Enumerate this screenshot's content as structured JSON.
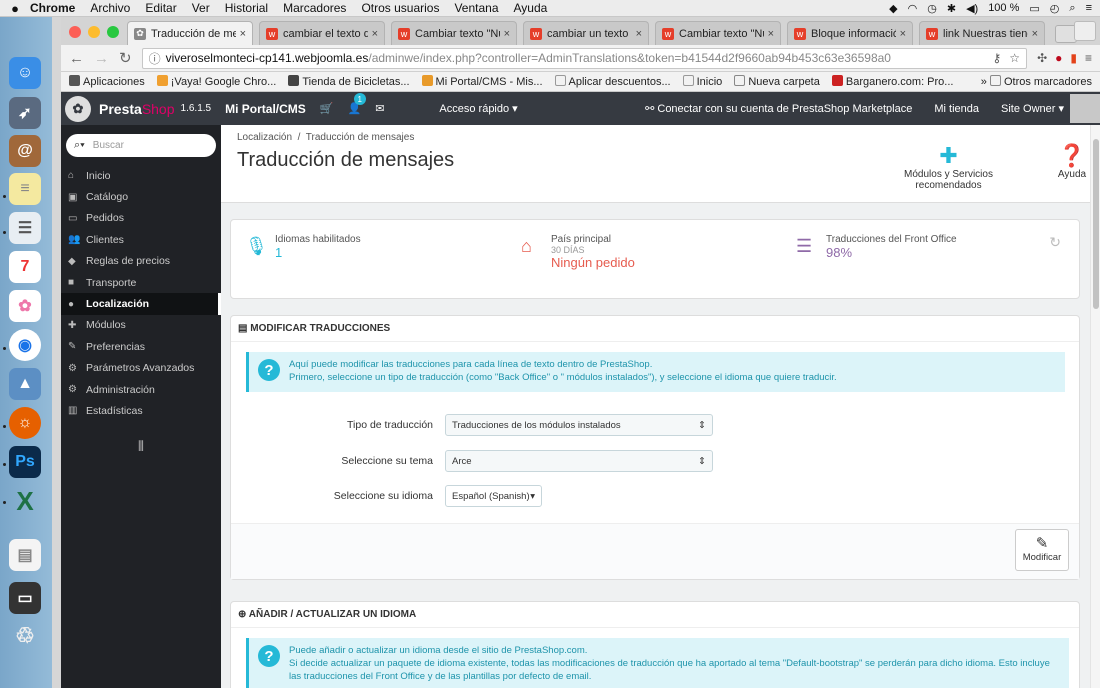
{
  "mac_menu": {
    "app": "Chrome",
    "items": [
      "Archivo",
      "Editar",
      "Ver",
      "Historial",
      "Marcadores",
      "Otros usuarios",
      "Ventana",
      "Ayuda"
    ],
    "battery": "100 %"
  },
  "tabs": [
    {
      "title": "Traducción de mensajes",
      "active": true
    },
    {
      "title": "cambiar el texto de los"
    },
    {
      "title": "Cambiar texto \"Nuestras"
    },
    {
      "title": "cambiar un texto"
    },
    {
      "title": "Cambiar texto \"Nuestras"
    },
    {
      "title": "Bloque información"
    },
    {
      "title": "link Nuestras tiendas"
    }
  ],
  "address": {
    "host": "viveroselmonteci-cp141.webjoomla.es",
    "path": "/adminwe/index.php?controller=AdminTranslations&token=b41544d2f9660ab94b453c63e36598a0"
  },
  "bookmarks": {
    "items": [
      "Aplicaciones",
      "¡Vaya! Google Chro...",
      "Tienda de Bicicletas...",
      "Mi Portal/CMS - Mis...",
      "Aplicar descuentos...",
      "Inicio",
      "Nueva carpeta",
      "Barganero.com: Pro..."
    ],
    "other": "Otros marcadores"
  },
  "header": {
    "brand_a": "Presta",
    "brand_b": "Shop",
    "version": "1.6.1.5",
    "portal": "Mi Portal/CMS",
    "badge": "1",
    "quick_access": "Acceso rápido",
    "connect": "Conectar con su cuenta de PrestaShop Marketplace",
    "my_store": "Mi tienda",
    "owner": "Site Owner"
  },
  "sidebar": {
    "search_placeholder": "Buscar",
    "items": [
      {
        "label": "Inicio",
        "icon": "home-icon",
        "glyph": "⌂"
      },
      {
        "label": "Catálogo",
        "icon": "catalog-icon",
        "glyph": "▣"
      },
      {
        "label": "Pedidos",
        "icon": "credit-card-icon",
        "glyph": "▭"
      },
      {
        "label": "Clientes",
        "icon": "users-icon",
        "glyph": "👥"
      },
      {
        "label": "Reglas de precios",
        "icon": "tags-icon",
        "glyph": "◆"
      },
      {
        "label": "Transporte",
        "icon": "truck-icon",
        "glyph": "■"
      },
      {
        "label": "Localización",
        "icon": "globe-icon",
        "glyph": "●",
        "active": true
      },
      {
        "label": "Módulos",
        "icon": "puzzle-icon",
        "glyph": "✚"
      },
      {
        "label": "Preferencias",
        "icon": "wrench-icon",
        "glyph": "✎"
      },
      {
        "label": "Parámetros Avanzados",
        "icon": "cogs-icon",
        "glyph": "⚙"
      },
      {
        "label": "Administración",
        "icon": "cog-icon",
        "glyph": "⚙"
      },
      {
        "label": "Estadísticas",
        "icon": "bar-chart-icon",
        "glyph": "▥"
      }
    ]
  },
  "page": {
    "breadcrumb": [
      "Localización",
      "Traducción de mensajes"
    ],
    "title": "Traducción de mensajes",
    "toolbar": {
      "modules": "Módulos y Servicios recomendados",
      "help": "Ayuda"
    }
  },
  "kpis": [
    {
      "label": "Idiomas habilitados",
      "value": "1",
      "color": "#25b9d7",
      "icon": "microphone-icon"
    },
    {
      "label": "País principal",
      "sub": "30 DÍAS",
      "value": "Ningún pedido",
      "color": "#e65c4f",
      "icon": "home-icon"
    },
    {
      "label": "Traducciones del Front Office",
      "value": "98%",
      "color": "#8f6aa8",
      "icon": "list-icon"
    }
  ],
  "modify_panel": {
    "heading": "MODIFICAR TRADUCCIONES",
    "info_line1": "Aquí puede modificar las traducciones para cada línea de texto dentro de PrestaShop.",
    "info_line2": "Primero, seleccione un tipo de traducción (como \"Back Office\" o \" módulos instalados\"), y seleccione el idioma que quiere traducir.",
    "type_label": "Tipo de traducción",
    "type_value": "Traducciones de los módulos instalados",
    "theme_label": "Seleccione su tema",
    "theme_value": "Arce",
    "lang_label": "Seleccione su idioma",
    "lang_value": "Español (Spanish)",
    "button": "Modificar"
  },
  "add_panel": {
    "heading": "AÑADIR / ACTUALIZAR UN IDIOMA",
    "info_line1": "Puede añadir o actualizar un idioma desde el sitio de PrestaShop.com.",
    "info_line2": "Si decide actualizar un paquete de idioma existente, todas las modificaciones de traducción que ha aportado al tema \"Default-bootstrap\" se perderán para dicho idioma. Esto incluye las traducciones del Front Office y de las plantillas por defecto de email."
  }
}
